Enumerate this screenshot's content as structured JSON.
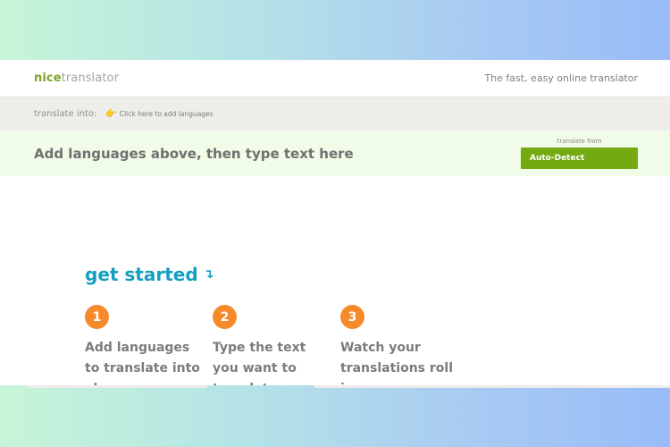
{
  "header": {
    "logo_part1": "nice",
    "logo_part2": "translator",
    "tagline": "The fast, easy online translator"
  },
  "translate_bar": {
    "label": "translate into:",
    "add_languages_link": "Click here to add languages",
    "hand_icon": "pointing-hand-icon"
  },
  "input_area": {
    "prompt": "Add languages above, then type text here",
    "from_label": "translate from",
    "auto_detect_button": "Auto-Detect"
  },
  "get_started": {
    "heading": "get started",
    "arrow_icon": "down-right-arrow-icon",
    "steps": [
      {
        "number": "1",
        "text": "Add languages to translate into above."
      },
      {
        "number": "2",
        "text": "Type the text you want to translate."
      },
      {
        "number": "3",
        "text": "Watch your translations roll in."
      }
    ]
  },
  "colors": {
    "brand_green": "#74a912",
    "accent_blue": "#139fc1",
    "step_orange": "#f58a2a"
  }
}
